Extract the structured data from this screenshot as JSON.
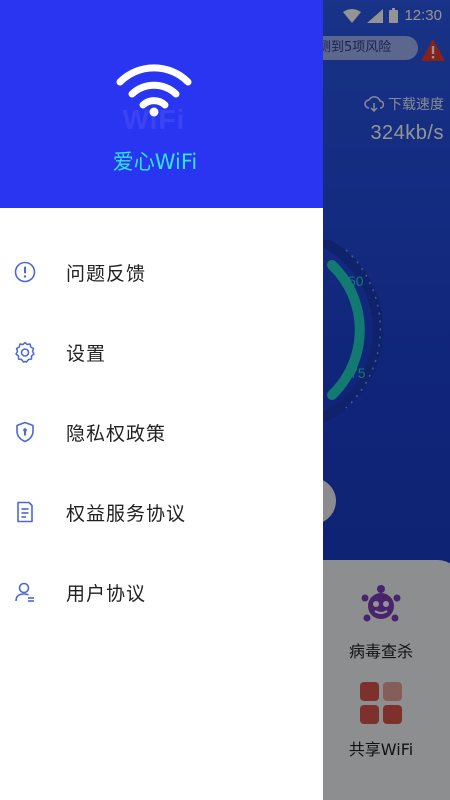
{
  "status_bar": {
    "time": "12:30"
  },
  "background": {
    "risk_text": "测到5项风险",
    "download_label": "下载速度",
    "download_speed": "324kb/s",
    "gauge_ticks": [
      "50",
      "75"
    ],
    "features": [
      {
        "label": "病毒查杀",
        "icon": "virus-icon"
      },
      {
        "label": "共享WiFi",
        "icon": "share-grid-icon"
      }
    ]
  },
  "drawer": {
    "logo_watermark": "WiFi",
    "app_name": "爱心WiFi",
    "menu": [
      {
        "label": "问题反馈",
        "icon": "feedback-icon"
      },
      {
        "label": "设置",
        "icon": "gear-icon"
      },
      {
        "label": "隐私权政策",
        "icon": "shield-icon"
      },
      {
        "label": "权益服务协议",
        "icon": "document-icon"
      },
      {
        "label": "用户协议",
        "icon": "user-icon"
      }
    ]
  },
  "colors": {
    "drawer_header": "#2a35f2",
    "app_name": "#2ee6e0",
    "menu_icon": "#4a68d8",
    "gauge_accent": "#22d3c5"
  }
}
